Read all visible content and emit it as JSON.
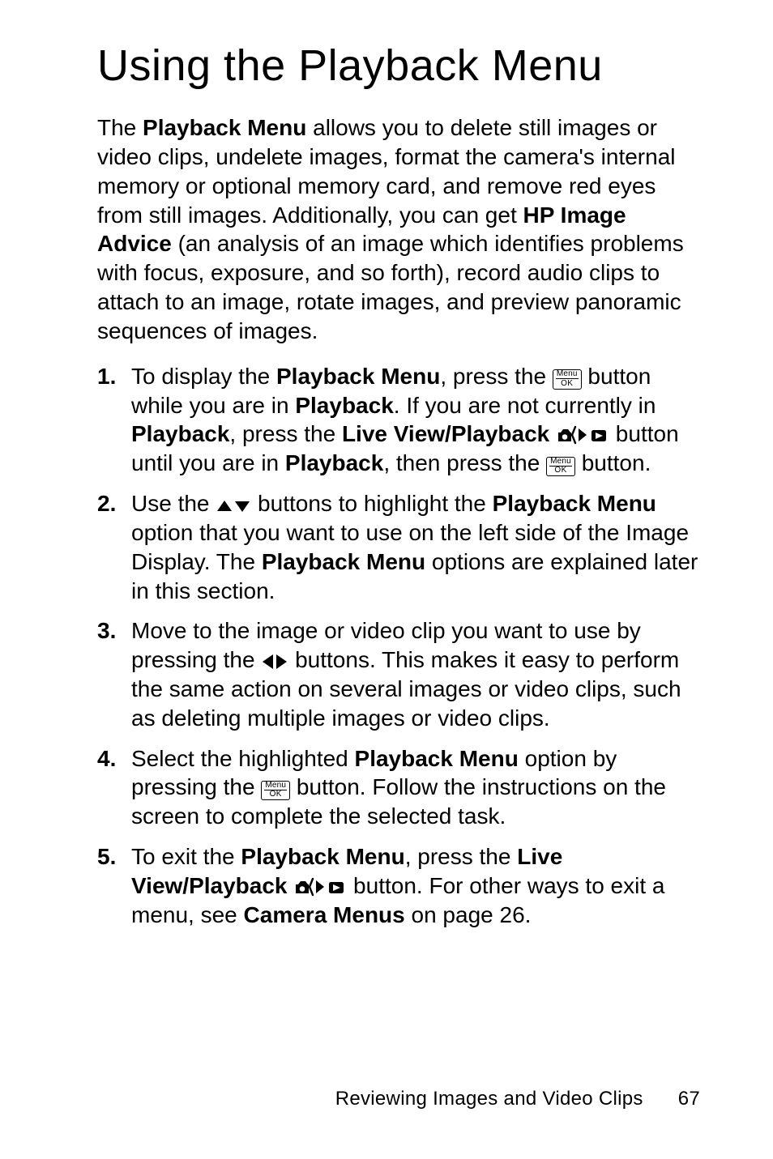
{
  "title": "Using the Playback Menu",
  "intro_parts": {
    "p1": "The ",
    "pb_menu": "Playback Menu",
    "p2": " allows you to delete still images or video clips, undelete images, format the camera's internal memory or optional memory card, and remove red eyes from still images. Additionally, you can get ",
    "hp_ia": "HP Image Advice",
    "p3": " (an analysis of an image which identifies problems with focus, exposure, and so forth), record audio clips to attach to an image, rotate images, and preview panoramic sequences of images."
  },
  "steps": {
    "s1": {
      "t1": "To display the ",
      "b1": "Playback Menu",
      "t2": ", press the ",
      "t3": " button while you are in ",
      "b2": "Playback",
      "t4": ". If you are not currently in ",
      "b3": "Playback",
      "t5": ", press the ",
      "b4": "Live View/Playback",
      "t6": " ",
      "t7": " button until you are in ",
      "b5": "Playback",
      "t8": ", then press the ",
      "t9": " button."
    },
    "s2": {
      "t1": "Use the ",
      "t2": " buttons to highlight the ",
      "b1": "Playback Menu",
      "t3": " option that you want to use on the left side of the Image Display. The ",
      "b2": "Playback Menu",
      "t4": " options are explained later in this section."
    },
    "s3": {
      "t1": "Move to the image or video clip you want to use by pressing the ",
      "t2": " buttons. This makes it easy to perform the same action on several images or video clips, such as deleting multiple images or video clips."
    },
    "s4": {
      "t1": "Select the highlighted ",
      "b1": "Playback Menu",
      "t2": " option by pressing the ",
      "t3": " button. Follow the instructions on the screen to complete the selected task."
    },
    "s5": {
      "t1": "To exit the ",
      "b1": "Playback Menu",
      "t2": ", press the ",
      "b2": "Live View/Playback",
      "t3": " ",
      "t4": " button. For other ways to exit a menu, see ",
      "b3": "Camera Menus",
      "t5": " on page 26."
    }
  },
  "menuok": {
    "top": "Menu",
    "bot": "OK"
  },
  "footer": {
    "text": "Reviewing Images and Video Clips",
    "page": "67"
  }
}
